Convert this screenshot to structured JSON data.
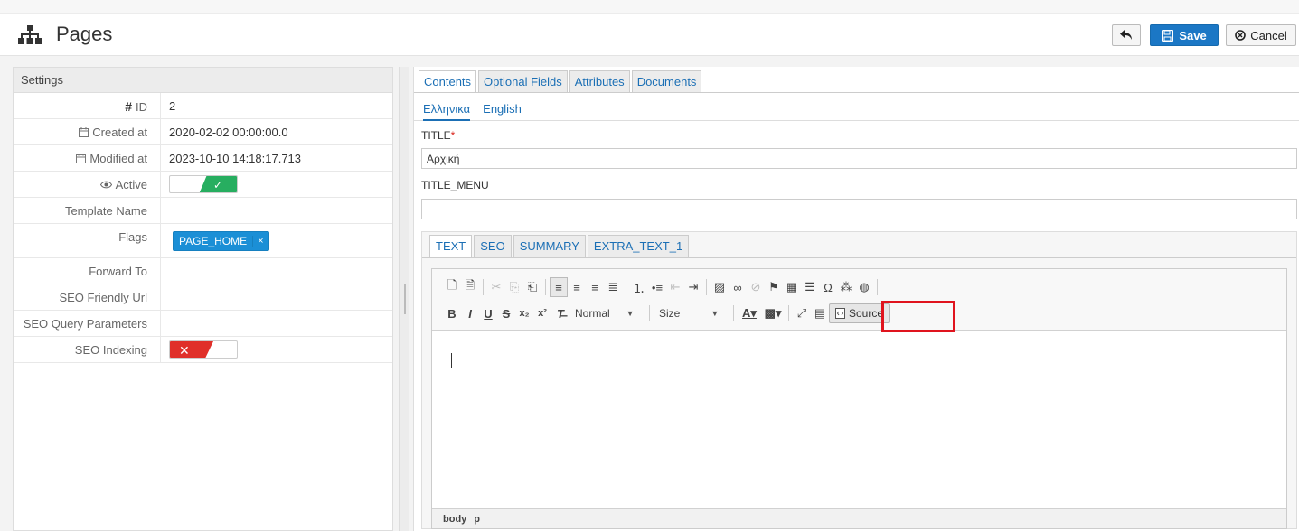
{
  "header": {
    "title": "Pages",
    "back_button": "",
    "save_label": "Save",
    "cancel_label": "Cancel"
  },
  "settings": {
    "panel_title": "Settings",
    "rows": [
      {
        "label": "ID",
        "value": "2"
      },
      {
        "label": "Created at",
        "value": "2020-02-02 00:00:00.0"
      },
      {
        "label": "Modified at",
        "value": "2023-10-10 14:18:17.713"
      },
      {
        "label": "Active",
        "value": ""
      },
      {
        "label": "Template Name",
        "value": ""
      },
      {
        "label": "Flags",
        "value": ""
      },
      {
        "label": "Forward To",
        "value": ""
      },
      {
        "label": "SEO Friendly Url",
        "value": ""
      },
      {
        "label": "SEO Query Parameters",
        "value": ""
      },
      {
        "label": "SEO Indexing",
        "value": ""
      }
    ],
    "active_on": true,
    "seo_indexing_on": false,
    "flag_tag": "PAGE_HOME",
    "flag_remove": "×"
  },
  "content": {
    "tabs": [
      "Contents",
      "Optional Fields",
      "Attributes",
      "Documents"
    ],
    "languages": [
      "Ελληνικα",
      "English"
    ],
    "title_label": "TITLE",
    "title_required": "*",
    "title_value": "Αρχική",
    "title_menu_label": "TITLE_MENU",
    "title_menu_value": "",
    "editor_tabs": [
      "TEXT",
      "SEO",
      "SUMMARY",
      "EXTRA_TEXT_1"
    ],
    "format_combo": "Normal",
    "size_combo": "Size",
    "source_label": "Source",
    "path": [
      "body",
      "p"
    ]
  }
}
